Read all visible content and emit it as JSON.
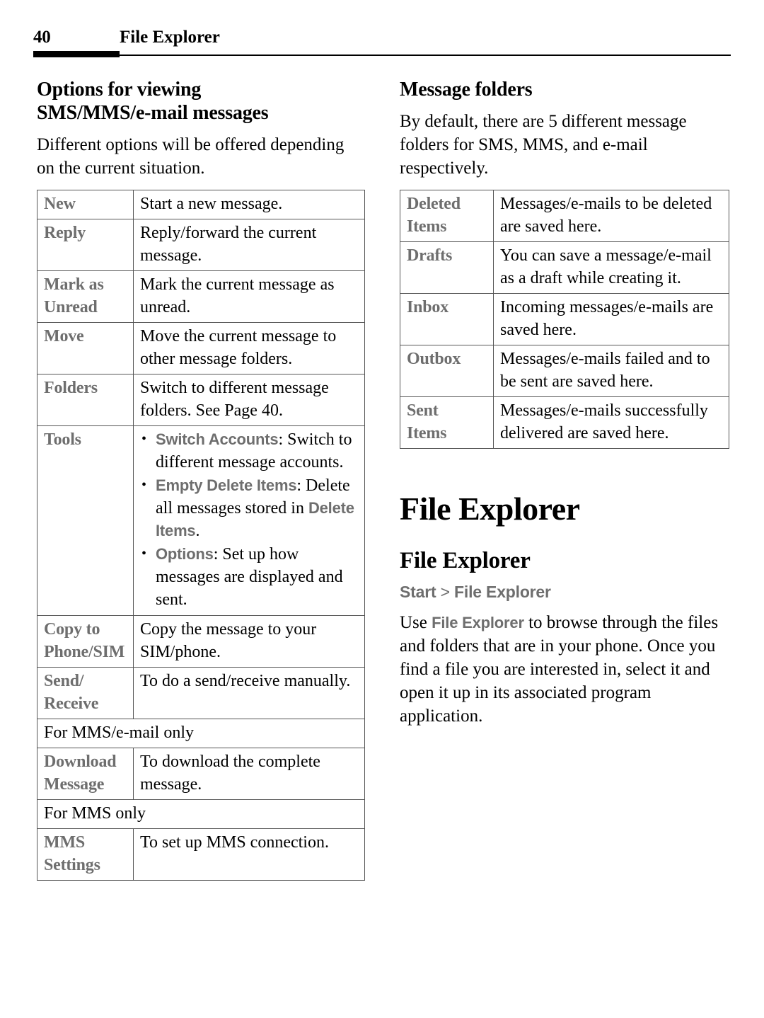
{
  "header": {
    "page_number": "40",
    "chapter": "File Explorer"
  },
  "left_column": {
    "heading_line1": "Options for viewing",
    "heading_line2": "SMS/MMS/e-mail messages",
    "intro": "Different options will be offered depending on the current situation.",
    "options_table": {
      "rows": [
        {
          "type": "pair",
          "term": "New",
          "desc": "Start a new message."
        },
        {
          "type": "pair",
          "term": "Reply",
          "desc": "Reply/forward the current message."
        },
        {
          "type": "pair",
          "term_line1": "Mark as",
          "term_line2": "Unread",
          "desc": "Mark the current message as unread."
        },
        {
          "type": "pair",
          "term": "Move",
          "desc": "Move the current message to other message folders."
        },
        {
          "type": "pair",
          "term": "Folders",
          "desc": "Switch to different message folders. See Page 40."
        },
        {
          "type": "bullets",
          "term": "Tools",
          "items": [
            {
              "ui": "Switch Accounts",
              "rest": ": Switch to different message accounts."
            },
            {
              "ui": "Empty Delete Items",
              "rest": ": Delete all messages stored in ",
              "ui2": "Delete Items",
              "rest2": "."
            },
            {
              "ui": "Options",
              "rest": ": Set up how messages are displayed and sent."
            }
          ]
        },
        {
          "type": "pair",
          "term_line1": "Copy to",
          "term_line2": "Phone/SIM",
          "desc": "Copy the message to your SIM/phone."
        },
        {
          "type": "pair",
          "term_line1": "Send/",
          "term_line2": "Receive",
          "desc": "To do a send/receive manually."
        },
        {
          "type": "span",
          "note": "For MMS/e-mail only"
        },
        {
          "type": "pair",
          "term_line1": "Download",
          "term_line2": "Message",
          "desc": "To download the complete message."
        },
        {
          "type": "span",
          "note": "For MMS only"
        },
        {
          "type": "pair",
          "term_line1": "MMS",
          "term_line2": "Settings",
          "desc": "To set up MMS connection."
        }
      ]
    }
  },
  "right_column": {
    "heading": "Message folders",
    "intro": "By default, there are 5 different message folders for SMS, MMS, and e-mail respectively.",
    "folders_table": {
      "rows": [
        {
          "term_line1": "Deleted",
          "term_line2": "Items",
          "desc": "Messages/e-mails to be deleted are saved here."
        },
        {
          "term": "Drafts",
          "desc": "You can save a message/e-mail as a draft while creating it."
        },
        {
          "term": "Inbox",
          "desc": "Incoming messages/e-mails are saved here."
        },
        {
          "term": "Outbox",
          "desc": "Messages/e-mails failed and to be sent are saved here."
        },
        {
          "term_line1": "Sent",
          "term_line2": "Items",
          "desc": "Messages/e-mails successfully delivered are saved here."
        }
      ]
    },
    "chapter_title": "File Explorer",
    "topic_heading": "File Explorer",
    "breadcrumb_start": "Start",
    "breadcrumb_sep": ">",
    "breadcrumb_target": "File Explorer",
    "body_pre": "Use ",
    "body_ui": "File Explorer",
    "body_post": " to browse through the files and folders that are in your phone. Once you find a file you are interested in, select it and open it up in its associated program application."
  },
  "colors": {
    "ui_term_gray": "#6e6e6e",
    "rule_black": "#000000",
    "table_border": "#555555"
  }
}
